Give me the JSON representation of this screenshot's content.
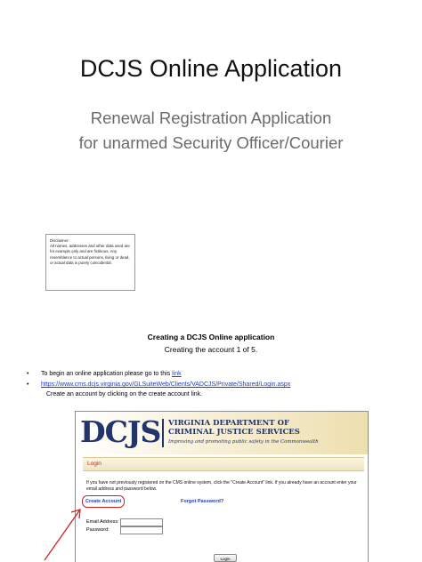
{
  "slide": {
    "title": "DCJS Online Application",
    "subtitle_line1": "Renewal Registration Application",
    "subtitle_line2": "for unarmed Security Officer/Courier"
  },
  "disclaimer": {
    "title": "Disclaimer:",
    "text": "All names, addresses and other data used are for example only and are fictitious. Any resemblance to actual persons, living or dead, or actual data is purely coincidental."
  },
  "section": {
    "heading": "Creating a DCJS Online application",
    "step": "Creating the account 1 of 5."
  },
  "instructions": {
    "bullet": "•",
    "line1_prefix": "To begin an online application please go to this ",
    "line1_link": "link",
    "line2_url": "https://www.cms.dcjs.virginia.gov/GLSuiteWeb/Clients/VADCJS/Private/Shared/Login.aspx",
    "line3": "Create an account by clicking on the create account link."
  },
  "screenshot": {
    "logo": "DCJS",
    "agency_line1": "VIRGINIA DEPARTMENT OF",
    "agency_line2": "CRIMINAL JUSTICE SERVICES",
    "tagline": "Improving and promoting public safety in the Commonwealth",
    "login_title": "Login",
    "instruction": "If you have not previously registered on the CMS online system, click the \"Create Account\" link. If you already have an account enter your email address and password below.",
    "create_account": "Create Account",
    "forgot_password": "Forgot Password?",
    "email_label": "Email Address:",
    "password_label": "Password:",
    "login_button": "Login"
  },
  "colors": {
    "link": "#1f3fbf",
    "logo": "#23336b",
    "highlight": "#cc2222"
  }
}
